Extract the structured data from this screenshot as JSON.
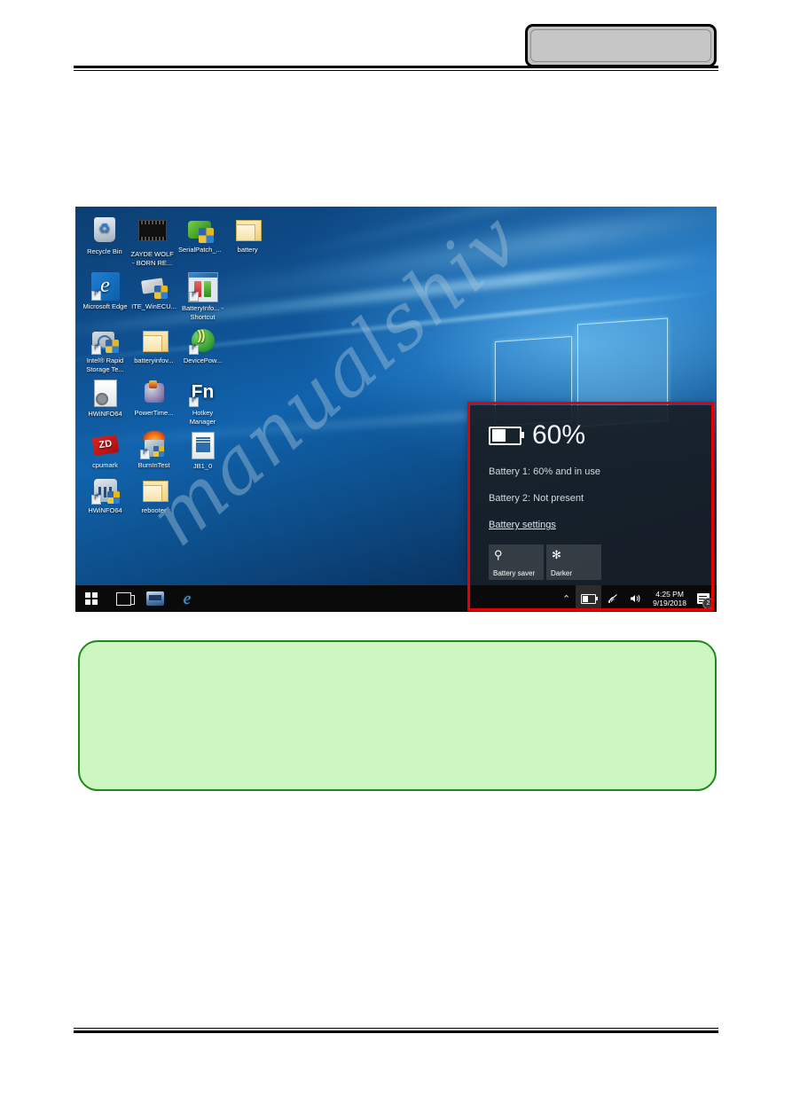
{
  "page": {
    "header_tab_label": "",
    "watermark": "manualshiv"
  },
  "desktop": {
    "icons": [
      [
        {
          "label": "Recycle Bin",
          "icon": "recycle-bin-icon",
          "shortcut": false
        },
        {
          "label": "ZAYDE WOLF - BORN RE...",
          "icon": "video-file-icon",
          "shortcut": false
        },
        {
          "label": "SerialPatch_...",
          "icon": "serial-patch-icon",
          "shortcut": false
        },
        {
          "label": "battery",
          "icon": "folder-icon",
          "shortcut": false
        }
      ],
      [
        {
          "label": "Microsoft Edge",
          "icon": "microsoft-edge-icon",
          "shortcut": true
        },
        {
          "label": "ITE_WinECU...",
          "icon": "ite-winecu-icon",
          "shortcut": false
        },
        {
          "label": "BatteryInfo... - Shortcut",
          "icon": "battery-info-icon",
          "shortcut": true
        }
      ],
      [
        {
          "label": "Intel® Rapid Storage Te...",
          "icon": "intel-rapid-storage-icon",
          "shortcut": true
        },
        {
          "label": "batteryinfov...",
          "icon": "folder-icon",
          "shortcut": false
        },
        {
          "label": "DevicePow...",
          "icon": "device-power-icon",
          "shortcut": true
        }
      ],
      [
        {
          "label": "HWiNFO64",
          "icon": "document-gear-icon",
          "shortcut": false
        },
        {
          "label": "PowerTime...",
          "icon": "power-time-icon",
          "shortcut": false
        },
        {
          "label": "Hotkey Manager",
          "icon": "fn-hotkey-icon",
          "shortcut": true
        }
      ],
      [
        {
          "label": "cpumark",
          "icon": "cpumark-zd-icon",
          "shortcut": false
        },
        {
          "label": "BurnInTest",
          "icon": "burnintest-icon",
          "shortcut": true
        },
        {
          "label": "JB1_0",
          "icon": "jb-file-icon",
          "shortcut": false
        }
      ],
      [
        {
          "label": "HWiNFO64",
          "icon": "hwinfo64-icon",
          "shortcut": true
        },
        {
          "label": "rebooter",
          "icon": "folder-icon",
          "shortcut": false
        }
      ]
    ]
  },
  "taskbar": {
    "start_label": "Start",
    "taskview_label": "Task View",
    "app_label": "App",
    "ie_label": "Internet Explorer",
    "tray": {
      "chevron": "⌃",
      "battery_label": "Battery",
      "network_label": "Network",
      "volume_label": "Volume",
      "time": "4:25 PM",
      "date": "9/19/2018",
      "notification_count": "2"
    }
  },
  "battery_flyout": {
    "percent": "60%",
    "battery1": "Battery 1: 60% and in use",
    "battery2": "Battery 2: Not present",
    "settings_link": "Battery settings",
    "tiles": [
      {
        "label": "Battery saver",
        "icon": "leaf-icon",
        "glyph": "⚲"
      },
      {
        "label": "Darker",
        "icon": "brightness-icon",
        "glyph": "✻"
      }
    ]
  },
  "colors": {
    "highlight_red": "#e60000",
    "note_green_fill": "#ccf7c0",
    "note_green_border": "#1a8a1a",
    "header_tab_gray": "#c3c3c3"
  }
}
